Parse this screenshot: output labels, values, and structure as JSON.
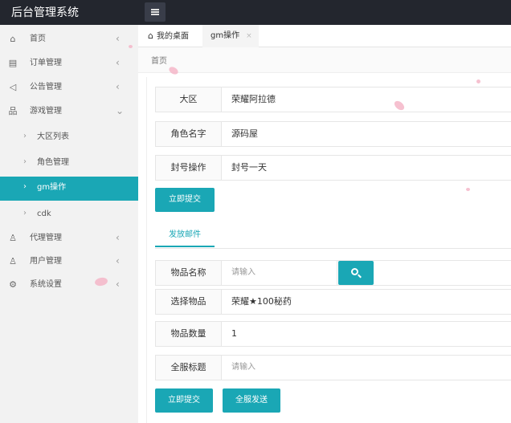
{
  "app": {
    "title": "后台管理系统"
  },
  "icons": {
    "menu_toggle": "menu-icon",
    "search": "search-icon"
  },
  "colors": {
    "accent": "#1aa7b5",
    "topbar": "#23262e",
    "sidebar": "#f2f2f2"
  },
  "sidebar": {
    "items": [
      {
        "label": "首页",
        "icon": "home-icon",
        "arrow": "‹"
      },
      {
        "label": "订单管理",
        "icon": "file-icon",
        "arrow": "‹"
      },
      {
        "label": "公告管理",
        "icon": "sound-icon",
        "arrow": "‹"
      },
      {
        "label": "游戏管理",
        "icon": "sitemap-icon",
        "arrow": "⌄"
      },
      {
        "label": "大区列表",
        "caret": "›"
      },
      {
        "label": "角色管理",
        "caret": "›"
      },
      {
        "label": "gm操作",
        "caret": "›"
      },
      {
        "label": "cdk",
        "caret": "›"
      },
      {
        "label": "代理管理",
        "icon": "user-icon",
        "arrow": "‹"
      },
      {
        "label": "用户管理",
        "icon": "user-icon",
        "arrow": "‹"
      },
      {
        "label": "系统设置",
        "icon": "gear-icon",
        "arrow": "‹"
      }
    ]
  },
  "tabs": [
    {
      "label": "我的桌面"
    },
    {
      "label": "gm操作",
      "close": "×"
    }
  ],
  "breadcrumb": "首页",
  "form_top": {
    "server_label": "大区",
    "server_value": "荣耀阿拉德",
    "role_label": "角色名字",
    "role_value": "源码屋",
    "ban_label": "封号操作",
    "ban_value": "封号一天",
    "submit_label": "立即提交"
  },
  "section_tab": "发放邮件",
  "form_mail": {
    "item_name_label": "物品名称",
    "item_name_placeholder": "请输入",
    "select_item_label": "选择物品",
    "select_item_value": "荣耀★100秘药",
    "quantity_label": "物品数量",
    "quantity_value": "1",
    "title_label": "全服标题",
    "title_placeholder": "请输入",
    "submit_label": "立即提交",
    "send_all_label": "全服发送"
  }
}
